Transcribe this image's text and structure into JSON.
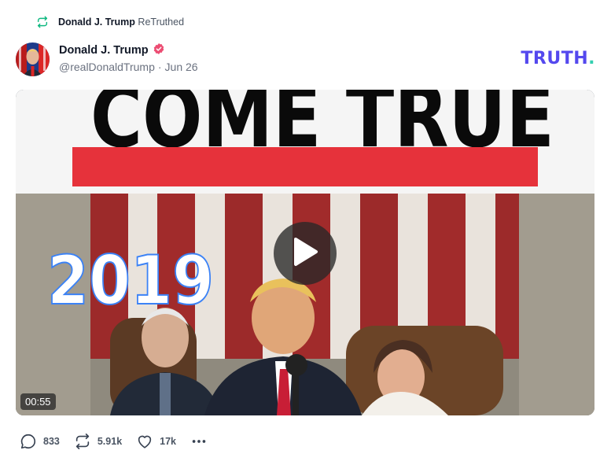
{
  "retruth": {
    "user": "Donald J. Trump",
    "label": "ReTruthed",
    "icon": "retruth-icon"
  },
  "post": {
    "display_name": "Donald J. Trump",
    "verified_icon": "verified-badge-icon",
    "handle": "@realDonaldTrump",
    "separator": "·",
    "date": "Jun 26"
  },
  "brand": {
    "logo_text": "TRUTH",
    "logo_dot": ".",
    "primary_color": "#5448ee",
    "accent_color": "#33cfb0"
  },
  "media": {
    "type": "video",
    "headline_text": "COME TRUE",
    "year_overlay": "2019",
    "duration": "00:55",
    "play_icon": "play-icon"
  },
  "actions": {
    "replies": {
      "icon": "reply-icon",
      "count": "833"
    },
    "retruths": {
      "icon": "retruth-icon",
      "count": "5.91k"
    },
    "likes": {
      "icon": "heart-icon",
      "count": "17k"
    },
    "more": {
      "icon": "more-icon"
    }
  },
  "colors": {
    "verified": "#ec4c72",
    "retruth_green": "#10b981",
    "headline_red": "#e6323b"
  }
}
